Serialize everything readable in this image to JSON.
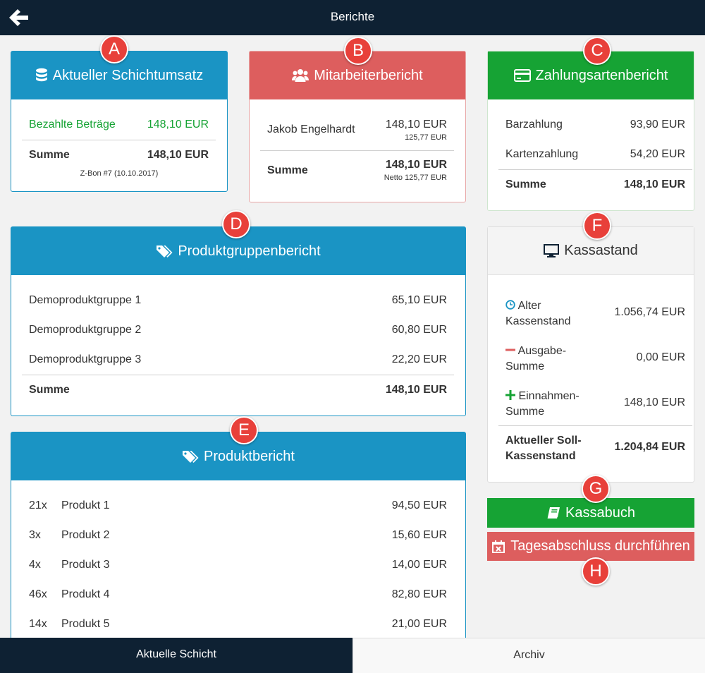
{
  "header": {
    "title": "Berichte"
  },
  "badges": [
    "A",
    "B",
    "C",
    "D",
    "E",
    "F",
    "G",
    "H"
  ],
  "schichtumsatz": {
    "title": "Aktueller Schichtumsatz",
    "paid_label": "Bezahlte Beträge",
    "paid_value": "148,10 EUR",
    "sum_label": "Summe",
    "sum_value": "148,10 EUR",
    "zbon": "Z-Bon #7 (10.10.2017)"
  },
  "mitarbeiter": {
    "title": "Mitarbeiterbericht",
    "employee_name": "Jakob Engelhardt",
    "employee_value": "148,10 EUR",
    "employee_net": "125,77 EUR",
    "sum_label": "Summe",
    "sum_value": "148,10 EUR",
    "sum_net": "Netto 125,77 EUR"
  },
  "zahlungsarten": {
    "title": "Zahlungsartenbericht",
    "rows": [
      {
        "label": "Barzahlung",
        "value": "93,90 EUR"
      },
      {
        "label": "Kartenzahlung",
        "value": "54,20 EUR"
      }
    ],
    "sum_label": "Summe",
    "sum_value": "148,10 EUR"
  },
  "produktgruppen": {
    "title": "Produktgruppenbericht",
    "rows": [
      {
        "label": "Demoproduktgruppe 1",
        "value": "65,10 EUR"
      },
      {
        "label": "Demoproduktgruppe 2",
        "value": "60,80 EUR"
      },
      {
        "label": "Demoproduktgruppe 3",
        "value": "22,20 EUR"
      }
    ],
    "sum_label": "Summe",
    "sum_value": "148,10 EUR"
  },
  "produkte": {
    "title": "Produktbericht",
    "rows": [
      {
        "qty": "21x",
        "label": "Produkt 1",
        "value": "94,50 EUR"
      },
      {
        "qty": "3x",
        "label": "Produkt 2",
        "value": "15,60 EUR"
      },
      {
        "qty": "4x",
        "label": "Produkt 3",
        "value": "14,00 EUR"
      },
      {
        "qty": "46x",
        "label": "Produkt 4",
        "value": "82,80 EUR"
      },
      {
        "qty": "14x",
        "label": "Produkt 5",
        "value": "21,00 EUR"
      }
    ]
  },
  "kassastand": {
    "title": "Kassastand",
    "alter_line1": "Alter",
    "alter_line2": "Kassenstand",
    "alter_value": "1.056,74 EUR",
    "ausgabe_line1": "Ausgabe-",
    "ausgabe_line2": "Summe",
    "ausgabe_value": "0,00 EUR",
    "einnahmen_line1": "Einnahmen-",
    "einnahmen_line2": "Summe",
    "einnahmen_value": "148,10 EUR",
    "soll_line1": "Aktueller Soll-",
    "soll_line2": "Kassenstand",
    "soll_value": "1.204,84 EUR"
  },
  "buttons": {
    "kassabuch": "Kassabuch",
    "tagesabschluss": "Tagesabschluss durchführen"
  },
  "tabs": {
    "active": "Aktuelle Schicht",
    "inactive": "Archiv"
  },
  "colors": {
    "blue": "#1a94c4",
    "red": "#dd5e5e",
    "green": "#16a334",
    "navy": "#0e2133",
    "badge": "#e8403a"
  }
}
